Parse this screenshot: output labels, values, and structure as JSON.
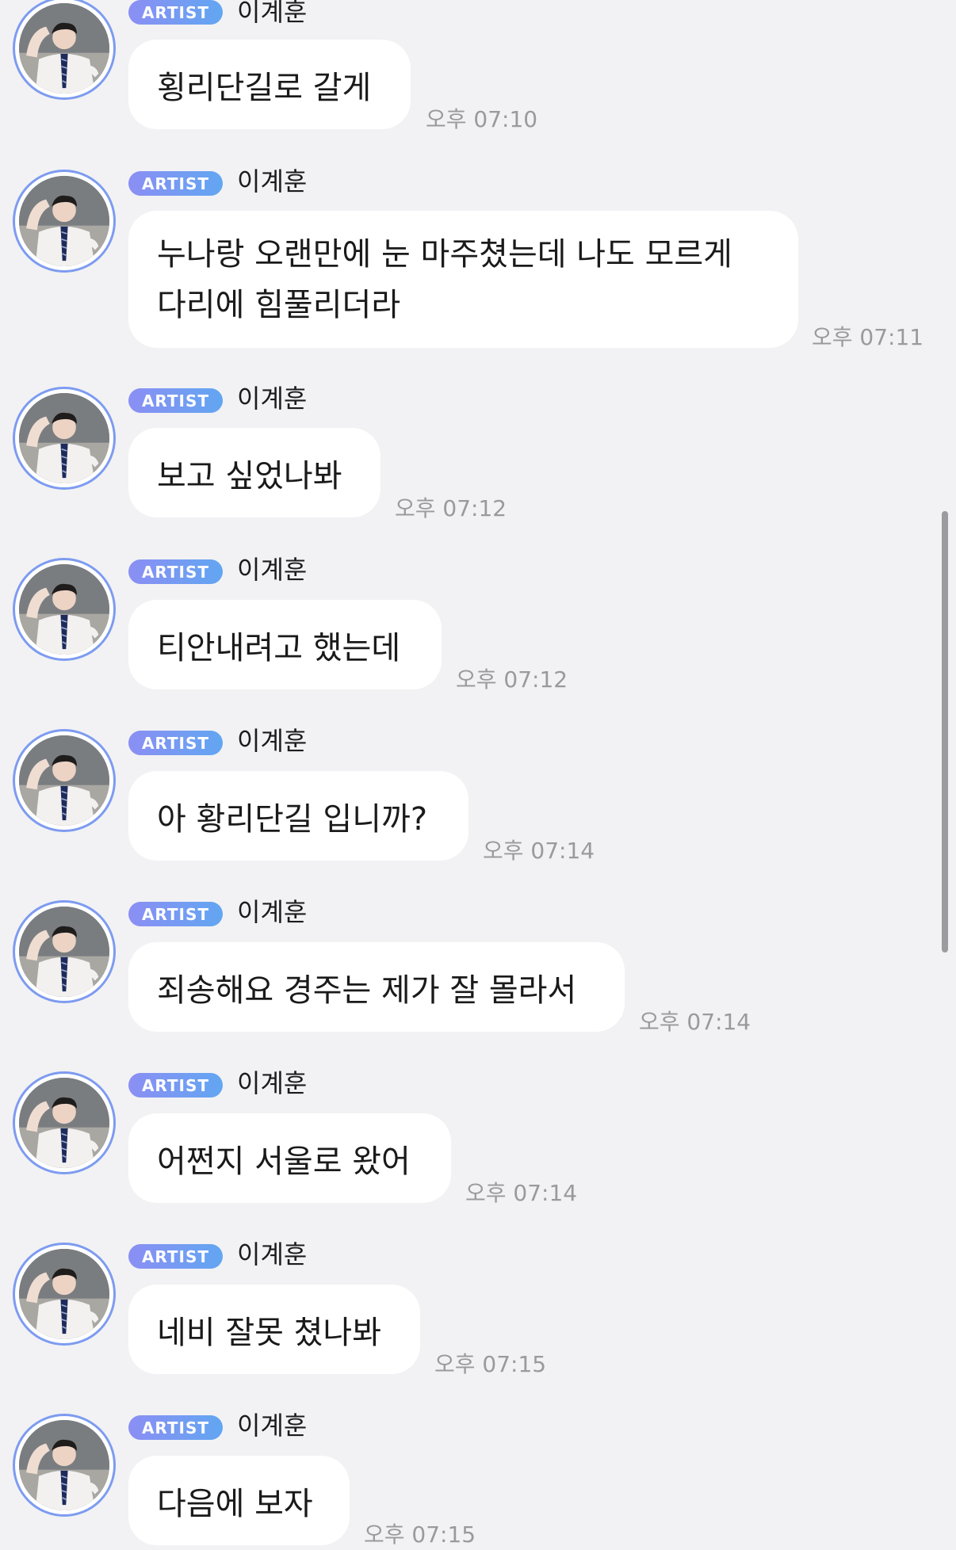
{
  "sender": {
    "badge": "ARTIST",
    "name": "이계훈"
  },
  "messages": [
    {
      "text": "횡리단길로 갈게",
      "time": "오후 07:10"
    },
    {
      "text": "누나랑 오랜만에 눈 마주쳤는데 나도 모르게 다리에 힘풀리더라",
      "time": "오후 07:11"
    },
    {
      "text": "보고 싶었나봐",
      "time": "오후 07:12"
    },
    {
      "text": "티안내려고 했는데",
      "time": "오후 07:12"
    },
    {
      "text": "아 황리단길 입니까?",
      "time": "오후 07:14"
    },
    {
      "text": "죄송해요 경주는 제가 잘 몰라서",
      "time": "오후 07:14"
    },
    {
      "text": "어쩐지 서울로 왔어",
      "time": "오후 07:14"
    },
    {
      "text": "네비 잘못 쳤나봐",
      "time": "오후 07:15"
    },
    {
      "text": "다음에 보자",
      "time": "오후 07:15"
    }
  ],
  "colors": {
    "background": "#f2f2f4",
    "bubble": "#ffffff",
    "badge_start": "#8b8ff3",
    "badge_end": "#62a6f2",
    "avatar_ring": "#7d9bf0"
  }
}
